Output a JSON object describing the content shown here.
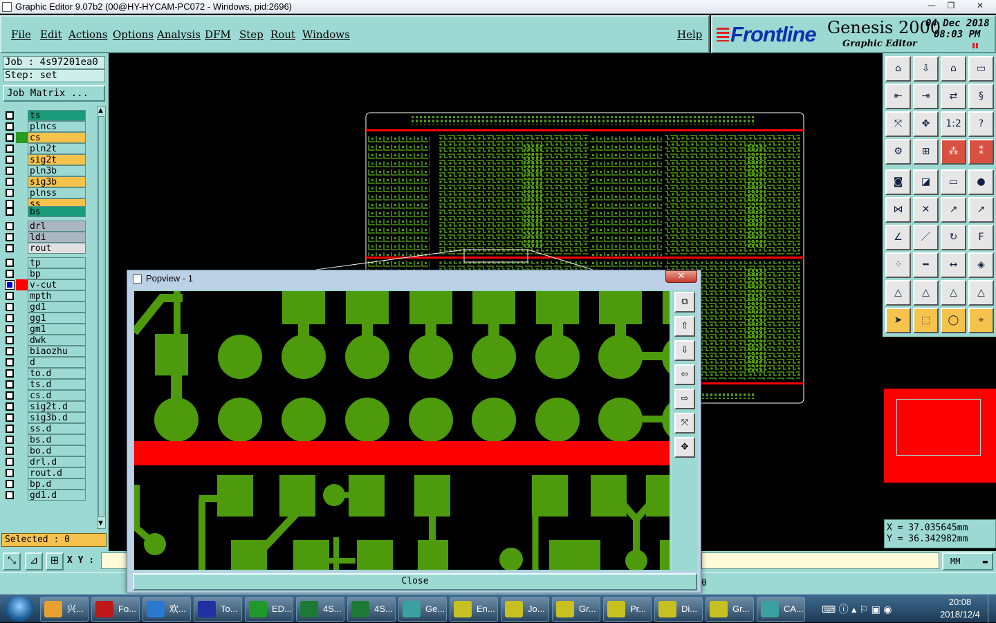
{
  "window": {
    "title": "Graphic Editor 9.07b2 (00@HY-HYCAM-PC072 - Windows, pid:2696)"
  },
  "menu": {
    "items": [
      "File",
      "Edit",
      "Actions",
      "Options",
      "Analysis",
      "DFM",
      "Step",
      "Rout",
      "Windows"
    ],
    "help": "Help"
  },
  "brand": {
    "logo": "Frontline",
    "product": "Genesis 2000",
    "subtitle": "Graphic Editor",
    "date": "04 Dec 2018",
    "time": "08:03 PM"
  },
  "job": {
    "job_label": "Job : 4s97201ea0",
    "step_label": "Step: set",
    "matrix_button": "Job Matrix ..."
  },
  "layers": [
    {
      "name": "ts",
      "color": "#1a9b7a"
    },
    {
      "name": "plncs",
      "color": "#9cd9d2"
    },
    {
      "name": "cs",
      "color": "#f5c24c",
      "swatch": "#2a9a22"
    },
    {
      "name": "pln2t",
      "color": "#9cd9d2"
    },
    {
      "name": "sig2t",
      "color": "#f5c24c"
    },
    {
      "name": "pln3b",
      "color": "#9cd9d2"
    },
    {
      "name": "sig3b",
      "color": "#f5c24c"
    },
    {
      "name": "plnss",
      "color": "#9cd9d2"
    },
    {
      "name": "ss",
      "color": "#f5c24c"
    },
    {
      "name": "bs",
      "color": "#1a9b7a"
    },
    {
      "name": "drl",
      "color": "#aab6c0"
    },
    {
      "name": "ldi",
      "color": "#aab6c0"
    },
    {
      "name": "rout",
      "color": "#e0e0e0"
    },
    {
      "name": "tp",
      "color": "#9cd9d2"
    },
    {
      "name": "bp",
      "color": "#9cd9d2"
    },
    {
      "name": "v-cut",
      "color": "#9cd9d2",
      "swatch": "#ff0000",
      "active": true
    },
    {
      "name": "mpth",
      "color": "#9cd9d2"
    },
    {
      "name": "gd1",
      "color": "#9cd9d2"
    },
    {
      "name": "gg1",
      "color": "#9cd9d2"
    },
    {
      "name": "gm1",
      "color": "#9cd9d2"
    },
    {
      "name": "dwk",
      "color": "#9cd9d2"
    },
    {
      "name": "biaozhu",
      "color": "#9cd9d2"
    },
    {
      "name": "d",
      "color": "#9cd9d2"
    },
    {
      "name": "to.d",
      "color": "#9cd9d2"
    },
    {
      "name": "ts.d",
      "color": "#9cd9d2"
    },
    {
      "name": "cs.d",
      "color": "#9cd9d2"
    },
    {
      "name": "sig2t.d",
      "color": "#9cd9d2"
    },
    {
      "name": "sig3b.d",
      "color": "#9cd9d2"
    },
    {
      "name": "ss.d",
      "color": "#9cd9d2"
    },
    {
      "name": "bs.d",
      "color": "#9cd9d2"
    },
    {
      "name": "bo.d",
      "color": "#9cd9d2"
    },
    {
      "name": "drl.d",
      "color": "#9cd9d2"
    },
    {
      "name": "rout.d",
      "color": "#9cd9d2"
    },
    {
      "name": "bp.d",
      "color": "#9cd9d2"
    },
    {
      "name": "gd1.d",
      "color": "#9cd9d2"
    }
  ],
  "selected": "Selected : 0",
  "xy": {
    "label": "X Y :",
    "value": ""
  },
  "units": "MM",
  "status_digit": "0",
  "coords": {
    "x": "X = 37.035645mm",
    "y": "Y = 36.342982mm"
  },
  "popview": {
    "title": "Popview - 1",
    "close_label": "Close"
  },
  "taskbar": {
    "items": [
      {
        "label": "兴...",
        "icon_color": "#e8a030"
      },
      {
        "label": "Fo...",
        "icon_color": "#c01818"
      },
      {
        "label": "欢...",
        "icon_color": "#2a78d0"
      },
      {
        "label": "To...",
        "icon_color": "#2030a0"
      },
      {
        "label": "ED...",
        "icon_color": "#1f9a2a"
      },
      {
        "label": "4S...",
        "icon_color": "#1d7a34"
      },
      {
        "label": "4S...",
        "icon_color": "#1d7a34"
      },
      {
        "label": "Ge...",
        "icon_color": "#3aa0a0"
      },
      {
        "label": "En...",
        "icon_color": "#c8c020"
      },
      {
        "label": "Jo...",
        "icon_color": "#c8c020"
      },
      {
        "label": "Gr...",
        "icon_color": "#c8c020"
      },
      {
        "label": "Pr...",
        "icon_color": "#c8c020"
      },
      {
        "label": "Di...",
        "icon_color": "#c8c020"
      },
      {
        "label": "Gr...",
        "icon_color": "#c8c020"
      },
      {
        "label": "CA...",
        "icon_color": "#3aa0a0"
      }
    ],
    "clock_time": "20:08",
    "clock_date": "2018/12/4"
  },
  "colors": {
    "panel": "#9cd9d2",
    "copper": "#4d9a0c",
    "vcut": "#ff0000",
    "navigator": "#ff0000"
  }
}
